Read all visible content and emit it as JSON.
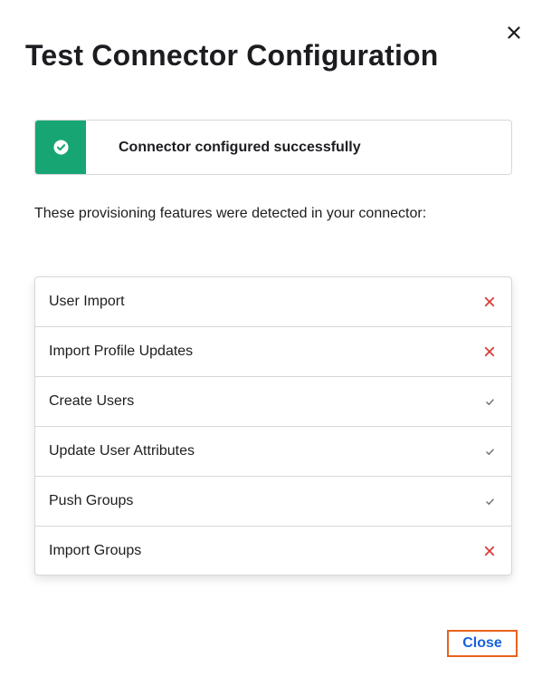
{
  "dialog": {
    "title": "Test Connector Configuration",
    "close_icon": "close-icon"
  },
  "banner": {
    "icon": "check-circle-icon",
    "message": "Connector configured successfully",
    "accent_color": "#17a673"
  },
  "description": "These provisioning features were detected in your connector:",
  "features": [
    {
      "label": "User Import",
      "detected": false
    },
    {
      "label": "Import Profile Updates",
      "detected": false
    },
    {
      "label": "Create Users",
      "detected": true
    },
    {
      "label": "Update User Attributes",
      "detected": true
    },
    {
      "label": "Push Groups",
      "detected": true
    },
    {
      "label": "Import Groups",
      "detected": false
    }
  ],
  "status_colors": {
    "not_detected": "#d93934",
    "detected": "#6e6e78"
  },
  "footer": {
    "close_label": "Close",
    "focus_outline_color": "#e8631c",
    "link_color": "#1662dd"
  }
}
